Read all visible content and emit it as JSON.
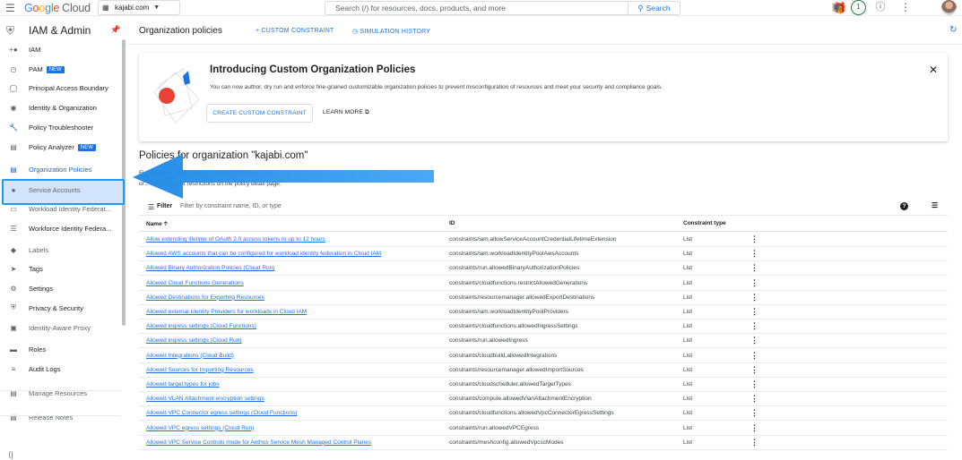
{
  "topbar": {
    "product_name": "Google Cloud",
    "project": "kajabi.com",
    "search_placeholder": "Search (/) for resources, docs, products, and more",
    "search_button": "Search",
    "notification_count": "1"
  },
  "sidebar": {
    "title": "IAM & Admin",
    "items": [
      {
        "label": "IAM",
        "icon": "person-add-icon",
        "new": false,
        "dim": false
      },
      {
        "label": "PAM",
        "icon": "clock-icon",
        "new": true,
        "dim": false
      },
      {
        "label": "Principal Access Boundary",
        "icon": "boundary-icon",
        "new": false,
        "dim": false
      },
      {
        "label": "Identity & Organization",
        "icon": "account-circle-icon",
        "new": false,
        "dim": false
      },
      {
        "label": "Policy Troubleshooter",
        "icon": "wrench-icon",
        "new": false,
        "dim": false
      },
      {
        "label": "Policy Analyzer",
        "icon": "document-search-icon",
        "new": true,
        "dim": false
      },
      {
        "label": "Organization Policies",
        "icon": "list-box-icon",
        "new": false,
        "dim": false,
        "active": true
      },
      {
        "label": "Service Accounts",
        "icon": "service-account-icon",
        "new": false,
        "dim": true
      },
      {
        "label": "Workload Identity Federat...",
        "icon": "workload-icon",
        "new": false,
        "dim": true
      },
      {
        "label": "Workforce Identity Federa...",
        "icon": "list-icon",
        "new": false,
        "dim": false
      },
      {
        "label": "Labels",
        "icon": "label-icon",
        "new": false,
        "dim": true
      },
      {
        "label": "Tags",
        "icon": "tag-icon",
        "new": false,
        "dim": false
      },
      {
        "label": "Settings",
        "icon": "gear-icon",
        "new": false,
        "dim": false
      },
      {
        "label": "Privacy & Security",
        "icon": "shield-icon",
        "new": false,
        "dim": false
      },
      {
        "label": "Identity-Aware Proxy",
        "icon": "proxy-icon",
        "new": false,
        "dim": true
      },
      {
        "label": "Roles",
        "icon": "roles-icon",
        "new": false,
        "dim": false
      },
      {
        "label": "Audit Logs",
        "icon": "logs-icon",
        "new": false,
        "dim": false
      },
      {
        "label": "Manage Resources",
        "icon": "folder-icon",
        "new": false,
        "dim": true
      },
      {
        "label": "Release Notes",
        "icon": "notes-icon",
        "new": false,
        "dim": true
      }
    ],
    "new_badge": "NEW"
  },
  "header": {
    "title": "Organization policies",
    "custom_constraint": "+ CUSTOM CONSTRAINT",
    "simulation_history": "SIMULATION HISTORY"
  },
  "banner": {
    "title": "Introducing Custom Organization Policies",
    "text": "You can now author, dry run and enforce fine-grained customizable organization policies to prevent misconfiguration of resources and meet your security and compliance goals.",
    "create_button": "CREATE CUSTOM CONSTRAINT",
    "learn_more": "LEARN MORE"
  },
  "section": {
    "title": "Policies for organization \"kajabi.com\"",
    "desc_line1": "Fi...                       constrain access to resources at and below this",
    "desc_line2": "or...                 . You can edit restrictions on the policy detail page."
  },
  "filter": {
    "label": "Filter",
    "placeholder": "Filter by constraint name, ID, or type"
  },
  "table": {
    "headers": {
      "name": "Name",
      "id": "ID",
      "type": "Constraint type"
    },
    "rows": [
      {
        "name": "Allow extending lifetime of OAuth 2.0 access tokens to up to 12 hours",
        "id": "constraints/iam.allowServiceAccountCredentialLifetimeExtension",
        "type": "List"
      },
      {
        "name": "Allowed AWS accounts that can be configured for workload identity federation in Cloud IAM",
        "id": "constraints/iam.workloadIdentityPoolAwsAccounts",
        "type": "List"
      },
      {
        "name": "Allowed Binary Authorization Policies (Cloud Run)",
        "id": "constraints/run.allowedBinaryAuthorizationPolicies",
        "type": "List"
      },
      {
        "name": "Allowed Cloud Functions Generations",
        "id": "constraints/cloudfunctions.restrictAllowedGenerations",
        "type": "List"
      },
      {
        "name": "Allowed Destinations for Exporting Resources",
        "id": "constraints/resourcemanager.allowedExportDestinations",
        "type": "List"
      },
      {
        "name": "Allowed external Identity Providers for workloads in Cloud IAM",
        "id": "constraints/iam.workloadIdentityPoolProviders",
        "type": "List"
      },
      {
        "name": "Allowed ingress settings (Cloud Functions)",
        "id": "constraints/cloudfunctions.allowedIngressSettings",
        "type": "List"
      },
      {
        "name": "Allowed ingress settings (Cloud Run)",
        "id": "constraints/run.allowedIngress",
        "type": "List"
      },
      {
        "name": "Allowed Integrations (Cloud Build)",
        "id": "constraints/cloudbuild.allowedIntegrations",
        "type": "List"
      },
      {
        "name": "Allowed Sources for Importing Resources",
        "id": "constraints/resourcemanager.allowedImportSources",
        "type": "List"
      },
      {
        "name": "Allowed target types for jobs",
        "id": "constraints/cloudscheduler.allowedTargetTypes",
        "type": "List"
      },
      {
        "name": "Allowed VLAN Attachment encryption settings",
        "id": "constraints/compute.allowedVlanAttachmentEncryption",
        "type": "List"
      },
      {
        "name": "Allowed VPC Connector egress settings (Cloud Functions)",
        "id": "constraints/cloudfunctions.allowedVpcConnectorEgressSettings",
        "type": "List"
      },
      {
        "name": "Allowed VPC egress settings (Cloud Run)",
        "id": "constraints/run.allowedVPCEgress",
        "type": "List"
      },
      {
        "name": "Allowed VPC Service Controls mode for Anthos Service Mesh Managed Control Planes",
        "id": "constraints/meshconfig.allowedVpcscModes",
        "type": "List"
      }
    ]
  },
  "colors": {
    "accent": "#1a73e8",
    "highlight": "#2196f3"
  }
}
